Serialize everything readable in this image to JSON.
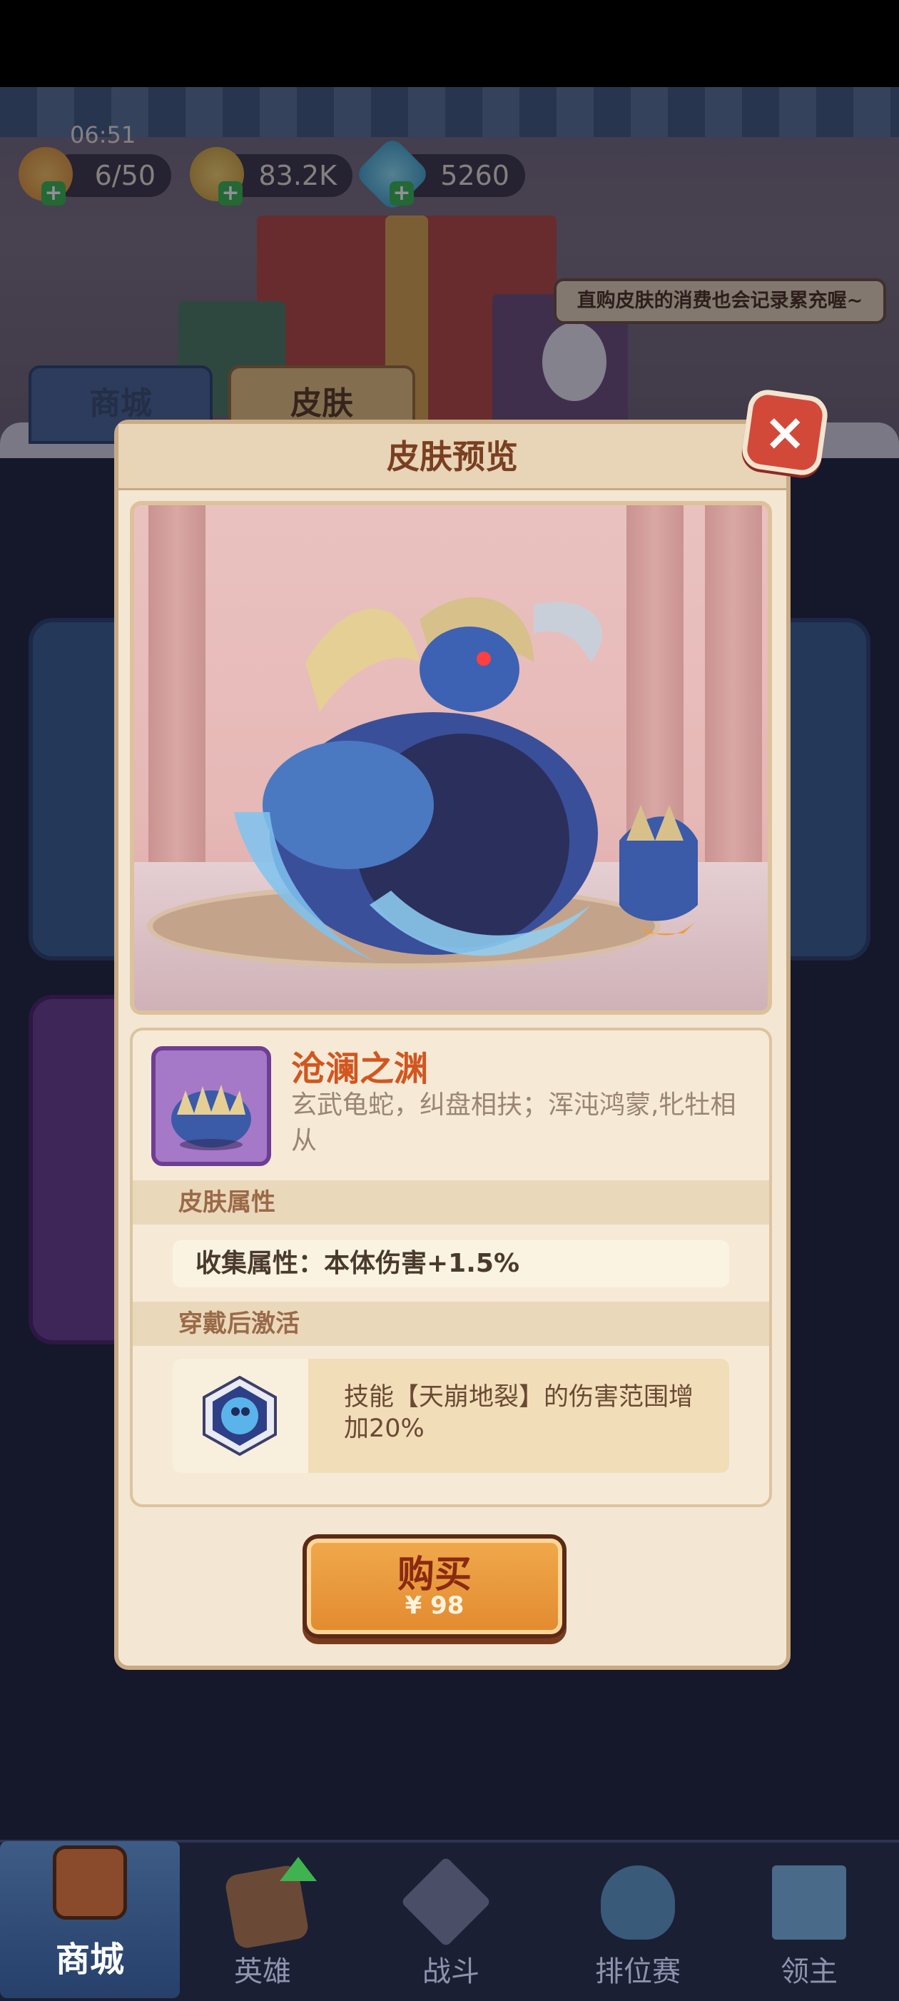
{
  "status": {
    "time": "06:51"
  },
  "resources": {
    "stamina": "6/50",
    "coins": "83.2K",
    "gems": "5260",
    "plus_symbol": "+"
  },
  "tip": "直购皮肤的消费也会记录累充喔~",
  "bg_tabs": {
    "shop": "商城",
    "skin": "皮肤"
  },
  "modal": {
    "title": "皮肤预览",
    "close_symbol": "×",
    "skin_name": "沧澜之渊",
    "skin_desc": "玄武龟蛇，纠盘相扶；浑沌鸿蒙,牝牡相从",
    "attr_section": "皮肤属性",
    "attr_value": "收集属性：本体伤害+1.5%",
    "wear_section": "穿戴后激活",
    "skill_text": "技能【天崩地裂】的伤害范围增加20%",
    "buy_label": "购买",
    "buy_price": "¥ 98"
  },
  "nav": {
    "items": [
      {
        "label": "商城",
        "icon": "chest-icon"
      },
      {
        "label": "英雄",
        "icon": "card-upgrade-icon"
      },
      {
        "label": "战斗",
        "icon": "crossed-swords-icon"
      },
      {
        "label": "排位赛",
        "icon": "rank-shield-icon"
      },
      {
        "label": "领主",
        "icon": "banner-icon"
      }
    ]
  },
  "colors": {
    "accent_orange": "#e38a2f",
    "close_red": "#d2493a",
    "name_orange": "#d2561f"
  }
}
